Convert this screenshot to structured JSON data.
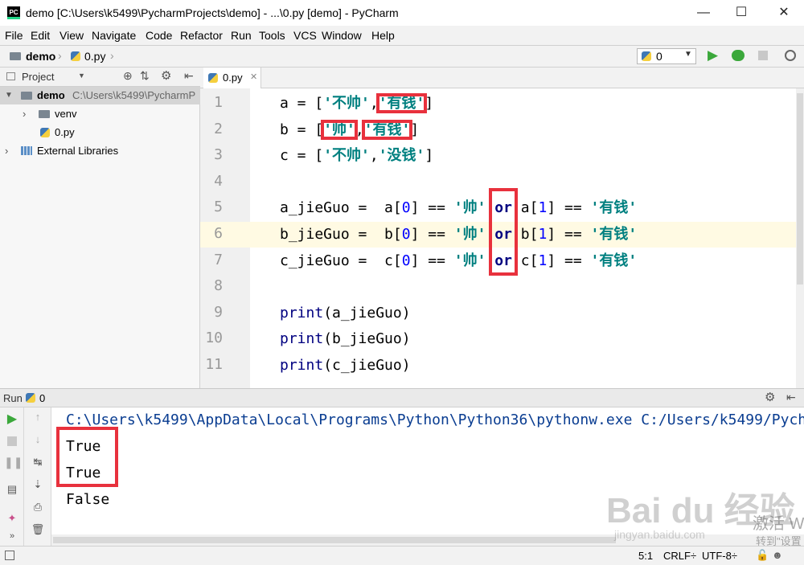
{
  "window": {
    "title": "demo [C:\\Users\\k5499\\PycharmProjects\\demo] - ...\\0.py [demo] - PyCharm",
    "app_icon_text": "PC"
  },
  "menu": [
    "File",
    "Edit",
    "View",
    "Navigate",
    "Code",
    "Refactor",
    "Run",
    "Tools",
    "VCS",
    "Window",
    "Help"
  ],
  "breadcrumb": {
    "project": "demo",
    "file": "0.py"
  },
  "run_config": {
    "selected": "0"
  },
  "project_panel": {
    "title": "Project",
    "root_name": "demo",
    "root_path": "C:\\Users\\k5499\\PycharmP",
    "items": [
      {
        "label": "venv"
      },
      {
        "label": "0.py"
      },
      {
        "label": "External Libraries"
      }
    ]
  },
  "editor": {
    "tab_label": "0.py",
    "line_numbers": [
      "1",
      "2",
      "3",
      "4",
      "5",
      "6",
      "7",
      "8",
      "9",
      "10",
      "11"
    ],
    "lines": [
      [
        {
          "t": "a = [",
          "c": ""
        },
        {
          "t": "'不帅'",
          "c": "str"
        },
        {
          "t": ",",
          "c": ""
        },
        {
          "t": "'有钱'",
          "c": "str"
        },
        {
          "t": "]",
          "c": ""
        }
      ],
      [
        {
          "t": "b = [",
          "c": ""
        },
        {
          "t": "'帅'",
          "c": "str"
        },
        {
          "t": ",",
          "c": ""
        },
        {
          "t": "'有钱'",
          "c": "str"
        },
        {
          "t": "]",
          "c": ""
        }
      ],
      [
        {
          "t": "c = [",
          "c": ""
        },
        {
          "t": "'不帅'",
          "c": "str"
        },
        {
          "t": ",",
          "c": ""
        },
        {
          "t": "'没钱'",
          "c": "str"
        },
        {
          "t": "]",
          "c": ""
        }
      ],
      [],
      [
        {
          "t": "a_jieGuo =  a[",
          "c": ""
        },
        {
          "t": "0",
          "c": "num"
        },
        {
          "t": "] == ",
          "c": ""
        },
        {
          "t": "'帅'",
          "c": "str"
        },
        {
          "t": " ",
          "c": ""
        },
        {
          "t": "or",
          "c": "kw"
        },
        {
          "t": " a[",
          "c": ""
        },
        {
          "t": "1",
          "c": "num"
        },
        {
          "t": "] == ",
          "c": ""
        },
        {
          "t": "'有钱'",
          "c": "str"
        }
      ],
      [
        {
          "t": "b_jieGuo =  b[",
          "c": ""
        },
        {
          "t": "0",
          "c": "num"
        },
        {
          "t": "] == ",
          "c": ""
        },
        {
          "t": "'帅'",
          "c": "str"
        },
        {
          "t": " ",
          "c": ""
        },
        {
          "t": "or",
          "c": "kw"
        },
        {
          "t": " b[",
          "c": ""
        },
        {
          "t": "1",
          "c": "num"
        },
        {
          "t": "] == ",
          "c": ""
        },
        {
          "t": "'有钱'",
          "c": "str"
        }
      ],
      [
        {
          "t": "c_jieGuo =  c[",
          "c": ""
        },
        {
          "t": "0",
          "c": "num"
        },
        {
          "t": "] == ",
          "c": ""
        },
        {
          "t": "'帅'",
          "c": "str"
        },
        {
          "t": " ",
          "c": ""
        },
        {
          "t": "or",
          "c": "kw"
        },
        {
          "t": " c[",
          "c": ""
        },
        {
          "t": "1",
          "c": "num"
        },
        {
          "t": "] == ",
          "c": ""
        },
        {
          "t": "'有钱'",
          "c": "str"
        }
      ],
      [],
      [
        {
          "t": "print",
          "c": "bi"
        },
        {
          "t": "(a_jieGuo)",
          "c": ""
        }
      ],
      [
        {
          "t": "print",
          "c": "bi"
        },
        {
          "t": "(b_jieGuo)",
          "c": ""
        }
      ],
      [
        {
          "t": "print",
          "c": "bi"
        },
        {
          "t": "(c_jieGuo)",
          "c": ""
        }
      ]
    ],
    "highlighted_line": 6
  },
  "run_panel": {
    "title": "Run",
    "config": "0",
    "console": [
      "C:\\Users\\k5499\\AppData\\Local\\Programs\\Python\\Python36\\pythonw.exe C:/Users/k5499/Pych",
      "True",
      "True",
      "False"
    ]
  },
  "status_bar": {
    "position": "5:1",
    "line_separator": "CRLF÷",
    "encoding": "UTF-8÷"
  },
  "watermark": {
    "brand": "Bai du 经验",
    "url": "jingyan.baidu.com",
    "activate": "激活 W",
    "goto": "转到\"设置"
  },
  "colors": {
    "annotation_red": "#e8313d",
    "string_teal": "#008080",
    "keyword_navy": "#000080",
    "run_green": "#3ba83b"
  }
}
